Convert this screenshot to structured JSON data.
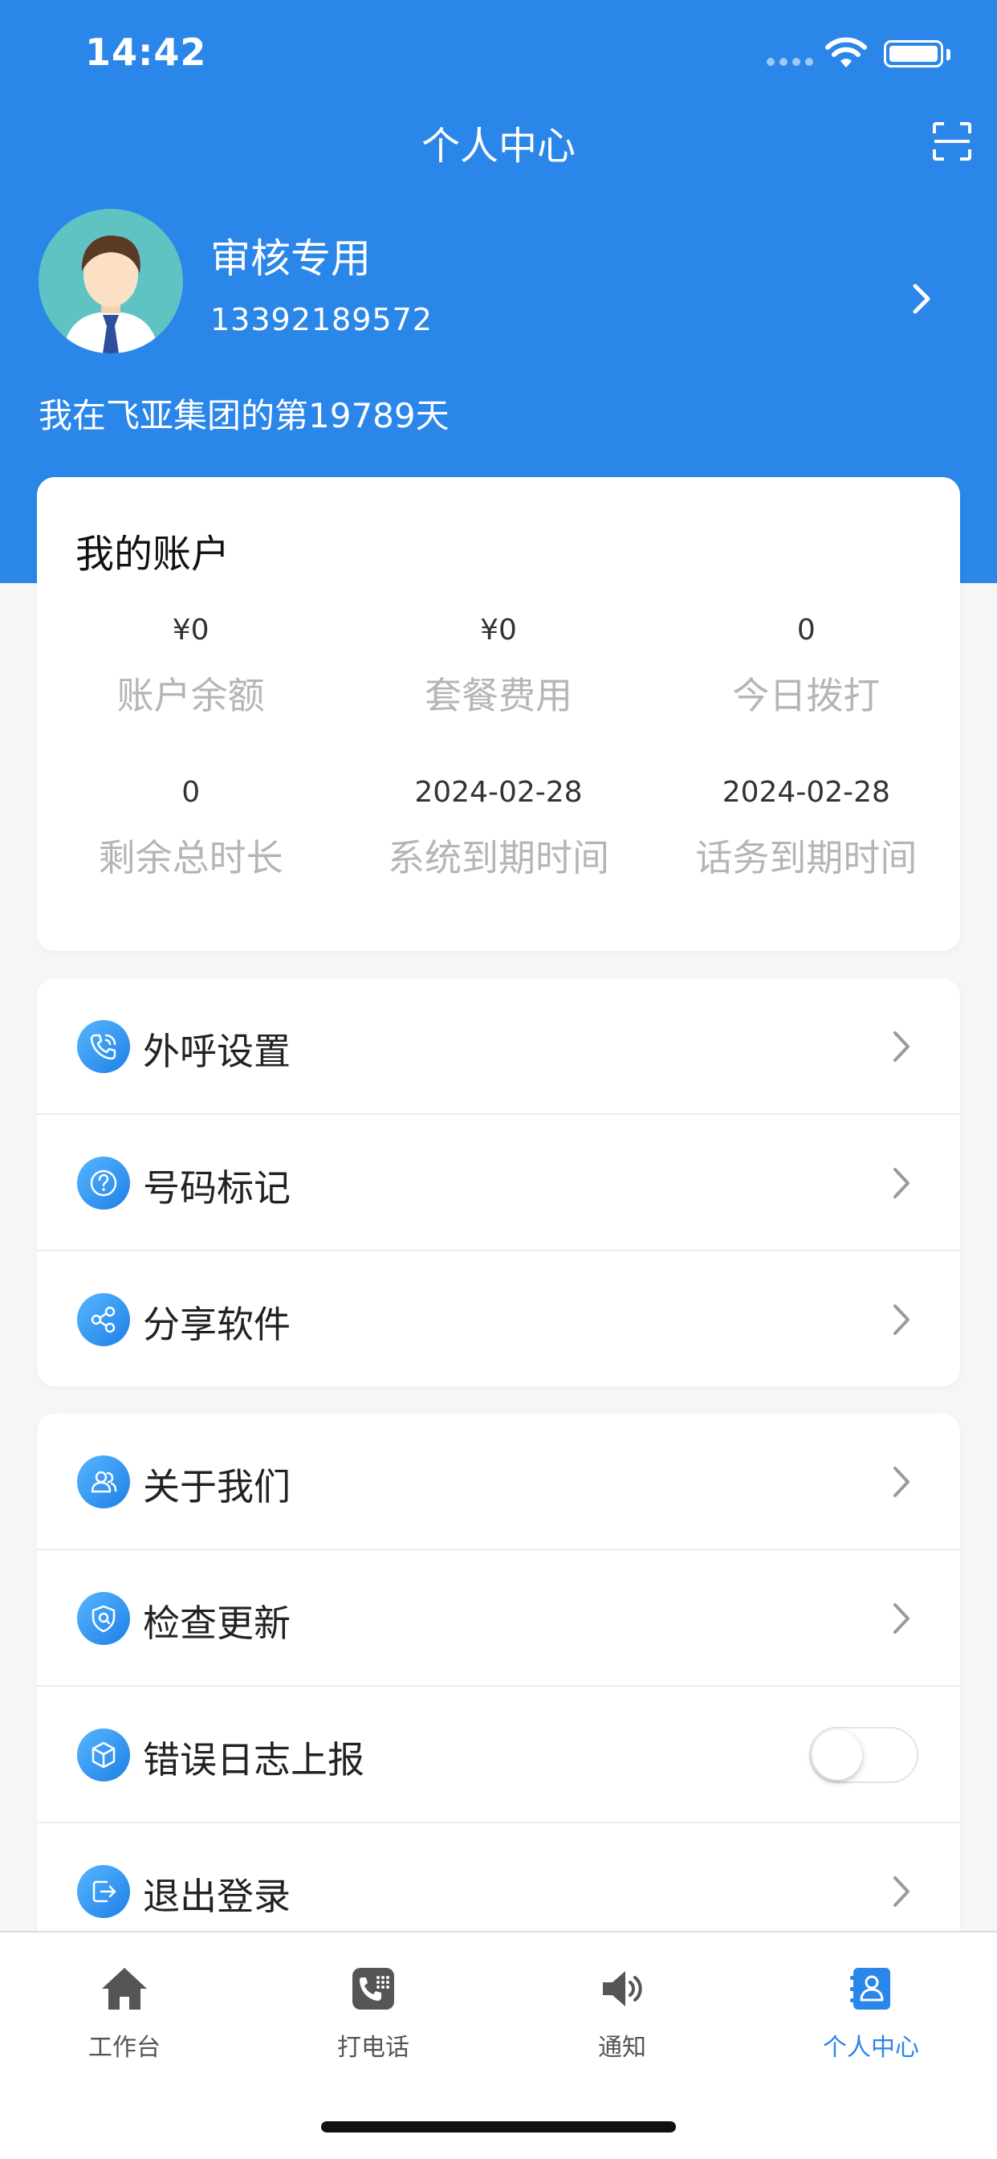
{
  "status_bar": {
    "time": "14:42"
  },
  "header": {
    "title": "个人中心"
  },
  "profile": {
    "name": "审核专用",
    "phone": "13392189572",
    "days_text": "我在飞亚集团的第19789天"
  },
  "account": {
    "title": "我的账户",
    "stats": [
      {
        "value": "¥0",
        "label": "账户余额"
      },
      {
        "value": "¥0",
        "label": "套餐费用"
      },
      {
        "value": "0",
        "label": "今日拨打"
      },
      {
        "value": "0",
        "label": "剩余总时长"
      },
      {
        "value": "2024-02-28",
        "label": "系统到期时间"
      },
      {
        "value": "2024-02-28",
        "label": "话务到期时间"
      }
    ]
  },
  "menu_group_1": [
    {
      "label": "外呼设置",
      "icon": "phone-settings-icon"
    },
    {
      "label": "号码标记",
      "icon": "question-icon"
    },
    {
      "label": "分享软件",
      "icon": "share-icon"
    }
  ],
  "menu_group_2": [
    {
      "label": "关于我们",
      "icon": "users-icon"
    },
    {
      "label": "检查更新",
      "icon": "shield-icon"
    },
    {
      "label": "错误日志上报",
      "icon": "box-icon",
      "toggle": false
    },
    {
      "label": "退出登录",
      "icon": "logout-icon"
    }
  ],
  "tab_bar": {
    "items": [
      {
        "label": "工作台",
        "icon": "home-icon"
      },
      {
        "label": "打电话",
        "icon": "phone-dialpad-icon"
      },
      {
        "label": "通知",
        "icon": "speaker-icon"
      },
      {
        "label": "个人中心",
        "icon": "contact-card-icon",
        "active": true
      }
    ]
  },
  "colors": {
    "primary": "#2a86e8",
    "background": "#f6f6f6",
    "muted_label": "#b5b5b5"
  }
}
